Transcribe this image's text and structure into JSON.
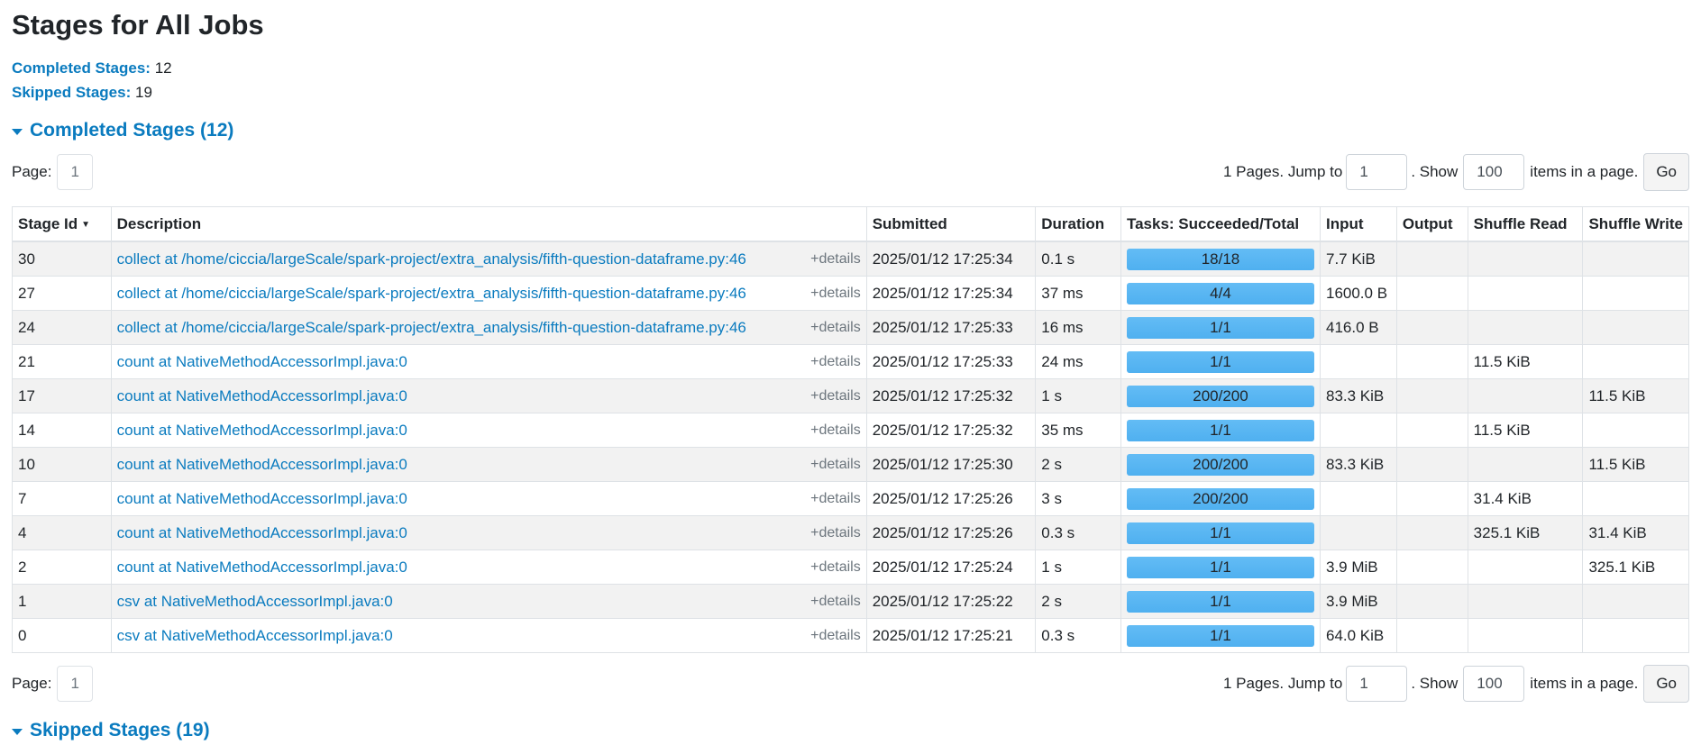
{
  "page": {
    "title": "Stages for All Jobs"
  },
  "summary": {
    "completed_label": "Completed Stages:",
    "completed_value": "12",
    "skipped_label": "Skipped Stages:",
    "skipped_value": "19"
  },
  "completed_section": {
    "header": "Completed Stages (12)"
  },
  "skipped_section": {
    "header": "Skipped Stages (19)"
  },
  "pager": {
    "page_label": "Page:",
    "current_page": "1",
    "pages_text": "1 Pages. Jump to",
    "jump_value": "1",
    "show_text": ". Show",
    "show_value": "100",
    "items_text": "items in a page.",
    "go_label": "Go"
  },
  "table": {
    "columns": [
      "Stage Id",
      "Description",
      "Submitted",
      "Duration",
      "Tasks: Succeeded/Total",
      "Input",
      "Output",
      "Shuffle Read",
      "Shuffle Write"
    ],
    "sort_column": "Stage Id",
    "details_label": "+details",
    "rows": [
      {
        "id": "30",
        "desc": "collect at /home/ciccia/largeScale/spark-project/extra_analysis/fifth-question-dataframe.py:46",
        "submitted": "2025/01/12 17:25:34",
        "duration": "0.1 s",
        "tasks": "18/18",
        "succeeded": 18,
        "total": 18,
        "input": "7.7 KiB",
        "output": "",
        "shuffle_read": "",
        "shuffle_write": ""
      },
      {
        "id": "27",
        "desc": "collect at /home/ciccia/largeScale/spark-project/extra_analysis/fifth-question-dataframe.py:46",
        "submitted": "2025/01/12 17:25:34",
        "duration": "37 ms",
        "tasks": "4/4",
        "succeeded": 4,
        "total": 4,
        "input": "1600.0 B",
        "output": "",
        "shuffle_read": "",
        "shuffle_write": ""
      },
      {
        "id": "24",
        "desc": "collect at /home/ciccia/largeScale/spark-project/extra_analysis/fifth-question-dataframe.py:46",
        "submitted": "2025/01/12 17:25:33",
        "duration": "16 ms",
        "tasks": "1/1",
        "succeeded": 1,
        "total": 1,
        "input": "416.0 B",
        "output": "",
        "shuffle_read": "",
        "shuffle_write": ""
      },
      {
        "id": "21",
        "desc": "count at NativeMethodAccessorImpl.java:0",
        "submitted": "2025/01/12 17:25:33",
        "duration": "24 ms",
        "tasks": "1/1",
        "succeeded": 1,
        "total": 1,
        "input": "",
        "output": "",
        "shuffle_read": "11.5 KiB",
        "shuffle_write": ""
      },
      {
        "id": "17",
        "desc": "count at NativeMethodAccessorImpl.java:0",
        "submitted": "2025/01/12 17:25:32",
        "duration": "1 s",
        "tasks": "200/200",
        "succeeded": 200,
        "total": 200,
        "input": "83.3 KiB",
        "output": "",
        "shuffle_read": "",
        "shuffle_write": "11.5 KiB"
      },
      {
        "id": "14",
        "desc": "count at NativeMethodAccessorImpl.java:0",
        "submitted": "2025/01/12 17:25:32",
        "duration": "35 ms",
        "tasks": "1/1",
        "succeeded": 1,
        "total": 1,
        "input": "",
        "output": "",
        "shuffle_read": "11.5 KiB",
        "shuffle_write": ""
      },
      {
        "id": "10",
        "desc": "count at NativeMethodAccessorImpl.java:0",
        "submitted": "2025/01/12 17:25:30",
        "duration": "2 s",
        "tasks": "200/200",
        "succeeded": 200,
        "total": 200,
        "input": "83.3 KiB",
        "output": "",
        "shuffle_read": "",
        "shuffle_write": "11.5 KiB"
      },
      {
        "id": "7",
        "desc": "count at NativeMethodAccessorImpl.java:0",
        "submitted": "2025/01/12 17:25:26",
        "duration": "3 s",
        "tasks": "200/200",
        "succeeded": 200,
        "total": 200,
        "input": "",
        "output": "",
        "shuffle_read": "31.4 KiB",
        "shuffle_write": ""
      },
      {
        "id": "4",
        "desc": "count at NativeMethodAccessorImpl.java:0",
        "submitted": "2025/01/12 17:25:26",
        "duration": "0.3 s",
        "tasks": "1/1",
        "succeeded": 1,
        "total": 1,
        "input": "",
        "output": "",
        "shuffle_read": "325.1 KiB",
        "shuffle_write": "31.4 KiB"
      },
      {
        "id": "2",
        "desc": "count at NativeMethodAccessorImpl.java:0",
        "submitted": "2025/01/12 17:25:24",
        "duration": "1 s",
        "tasks": "1/1",
        "succeeded": 1,
        "total": 1,
        "input": "3.9 MiB",
        "output": "",
        "shuffle_read": "",
        "shuffle_write": "325.1 KiB"
      },
      {
        "id": "1",
        "desc": "csv at NativeMethodAccessorImpl.java:0",
        "submitted": "2025/01/12 17:25:22",
        "duration": "2 s",
        "tasks": "1/1",
        "succeeded": 1,
        "total": 1,
        "input": "3.9 MiB",
        "output": "",
        "shuffle_read": "",
        "shuffle_write": ""
      },
      {
        "id": "0",
        "desc": "csv at NativeMethodAccessorImpl.java:0",
        "submitted": "2025/01/12 17:25:21",
        "duration": "0.3 s",
        "tasks": "1/1",
        "succeeded": 1,
        "total": 1,
        "input": "64.0 KiB",
        "output": "",
        "shuffle_read": "",
        "shuffle_write": ""
      }
    ]
  },
  "colors": {
    "link": "#0a7bbf",
    "progress_fill": "#5db7f3",
    "row_stripe": "#f2f2f2"
  },
  "icons": {
    "collapse": "caret-down-icon",
    "sort": "sort-desc-icon"
  }
}
